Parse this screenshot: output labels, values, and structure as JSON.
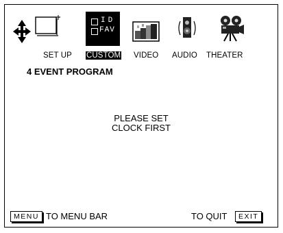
{
  "menu_bar": {
    "items": [
      {
        "label": "SET UP",
        "icon": "setup-icon",
        "selected": false
      },
      {
        "label": "CUSTOM",
        "icon": "custom-id-fav-icon",
        "selected": true,
        "icon_text_1": "ID",
        "icon_text_2": "FAV"
      },
      {
        "label": "VIDEO",
        "icon": "video-icon",
        "selected": false
      },
      {
        "label": "AUDIO",
        "icon": "speaker-icon",
        "selected": false
      },
      {
        "label": "THEATER",
        "icon": "movie-camera-icon",
        "selected": false
      }
    ]
  },
  "page_title": "4 EVENT PROGRAM",
  "message": {
    "line1": "PLEASE SET",
    "line2": "CLOCK FIRST"
  },
  "footer": {
    "menu_key": "MENU",
    "menu_text": "TO MENU BAR",
    "quit_text": "TO QUIT",
    "exit_key": "EXIT"
  }
}
